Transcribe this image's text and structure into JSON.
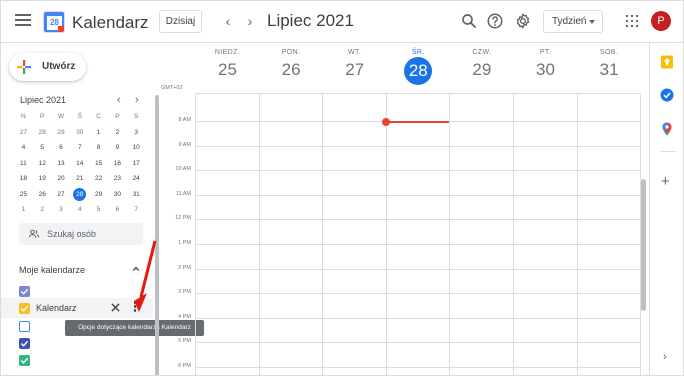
{
  "header": {
    "app_title": "Kalendarz",
    "logo_day": "28",
    "today_label": "Dzisiaj",
    "prev_label": "‹",
    "next_label": "›",
    "month_title": "Lipiec 2021",
    "view_label": "Tydzień",
    "avatar_letter": "P",
    "avatar_color": "#c5221f"
  },
  "sidebar": {
    "create_label": "Utwórz",
    "mini_calendar": {
      "title": "Lipiec 2021",
      "prev": "‹",
      "next": "›",
      "weekdays": [
        "N",
        "P",
        "W",
        "Ś",
        "C",
        "P",
        "S"
      ],
      "weeks": [
        [
          "27",
          "28",
          "29",
          "30",
          "1",
          "2",
          "3"
        ],
        [
          "4",
          "5",
          "6",
          "7",
          "8",
          "9",
          "10"
        ],
        [
          "11",
          "12",
          "13",
          "14",
          "15",
          "16",
          "17"
        ],
        [
          "18",
          "19",
          "20",
          "21",
          "22",
          "23",
          "24"
        ],
        [
          "25",
          "26",
          "27",
          "28",
          "29",
          "30",
          "31"
        ],
        [
          "1",
          "2",
          "3",
          "4",
          "5",
          "6",
          "7"
        ]
      ],
      "today": "28"
    },
    "search_people_placeholder": "Szukaj osób",
    "my_calendars_label": "Moje kalendarze",
    "calendars": [
      {
        "name": "",
        "color": "#7986cb"
      },
      {
        "name": "Kalendarz",
        "color": "#f6bf26"
      },
      {
        "name": "",
        "color": "#4285f4"
      },
      {
        "name": "",
        "color": "#3f51b5"
      },
      {
        "name": "",
        "color": "#33b679"
      }
    ],
    "tooltip": "Opcje dotyczące kalendarza Kalendarz"
  },
  "week": {
    "gmt_label": "GMT+02",
    "days": [
      {
        "name": "NIEDZ.",
        "date": "25",
        "current": false
      },
      {
        "name": "PON.",
        "date": "26",
        "current": false
      },
      {
        "name": "WT.",
        "date": "27",
        "current": false
      },
      {
        "name": "ŚR.",
        "date": "28",
        "current": true
      },
      {
        "name": "CZW.",
        "date": "29",
        "current": false
      },
      {
        "name": "PT.",
        "date": "30",
        "current": false
      },
      {
        "name": "SOB.",
        "date": "31",
        "current": false
      }
    ],
    "hours": [
      "8 AM",
      "9 AM",
      "10 AM",
      "11 AM",
      "12 PM",
      "1 PM",
      "2 PM",
      "3 PM",
      "4 PM",
      "5 PM",
      "6 PM"
    ]
  },
  "colors": {
    "accent": "#1a73e8",
    "now_indicator": "#ea4335",
    "annotation_arrow": "#e8180c"
  }
}
